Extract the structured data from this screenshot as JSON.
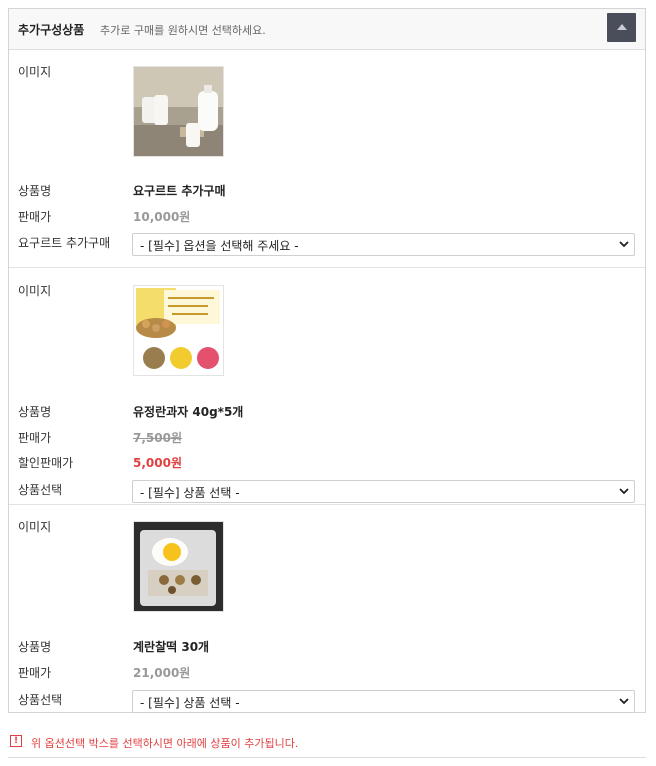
{
  "section": {
    "title": "추가구성상품",
    "description": "추가로 구매를 원하시면 선택하세요."
  },
  "labels": {
    "image": "이미지",
    "name": "상품명",
    "price": "판매가",
    "sale_price": "할인판매가",
    "product_select": "상품선택"
  },
  "products": [
    {
      "name": "요구르트 추가구매",
      "price": "10,000원",
      "select_label": "요구르트 추가구매",
      "select_value": "- [필수] 옵션을 선택해 주세요 -"
    },
    {
      "name": "유정란과자 40g*5개",
      "price": "7,500원",
      "sale_price": "5,000원",
      "select_value": "- [필수] 상품 선택 -"
    },
    {
      "name": "계란찰떡 30개",
      "price": "21,000원",
      "select_value": "- [필수] 상품 선택 -"
    }
  ],
  "notice": {
    "icon": "!",
    "text": "위 옵션선택 박스를 선택하시면 아래에 상품이 추가됩니다."
  },
  "colors": {
    "header_button": "#4a4d5a",
    "sale_red": "#e04040",
    "muted_price": "#999999"
  }
}
